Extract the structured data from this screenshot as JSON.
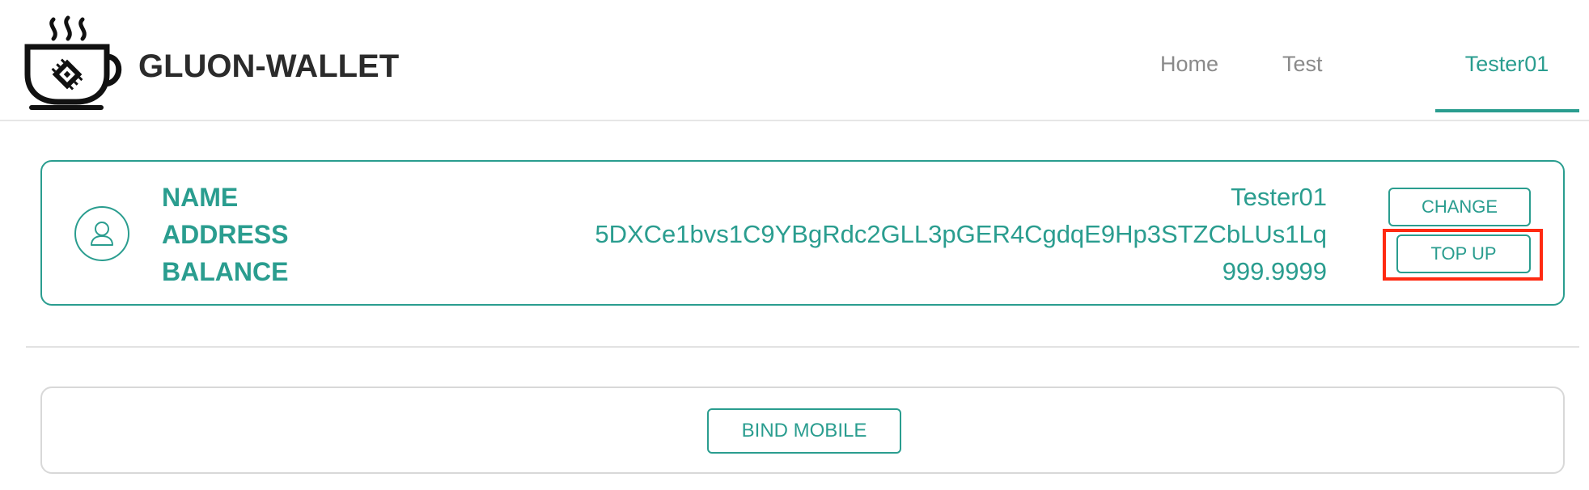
{
  "app": {
    "brand": "GLUON-WALLET",
    "logo_icon": "coffee-cup-chip-icon"
  },
  "nav": {
    "items": [
      {
        "label": "Home",
        "active": false
      },
      {
        "label": "Test",
        "active": false
      },
      {
        "label": "Tester01",
        "active": true
      }
    ]
  },
  "account": {
    "avatar_icon": "user-icon",
    "labels": {
      "name": "NAME",
      "address": "ADDRESS",
      "balance": "BALANCE"
    },
    "values": {
      "name": "Tester01",
      "address": "5DXCe1bvs1C9YBgRdc2GLL3pGER4CgdqE9Hp3STZCbLUs1Lq",
      "balance": "999.9999"
    },
    "buttons": {
      "change": "CHANGE",
      "top_up": "TOP UP"
    }
  },
  "mobile": {
    "bind_label": "BIND MOBILE"
  },
  "colors": {
    "accent": "#2a9d8f",
    "highlight": "#ff2a12",
    "brand_text": "#2b2b2b",
    "nav_text": "#8a8a8a"
  }
}
